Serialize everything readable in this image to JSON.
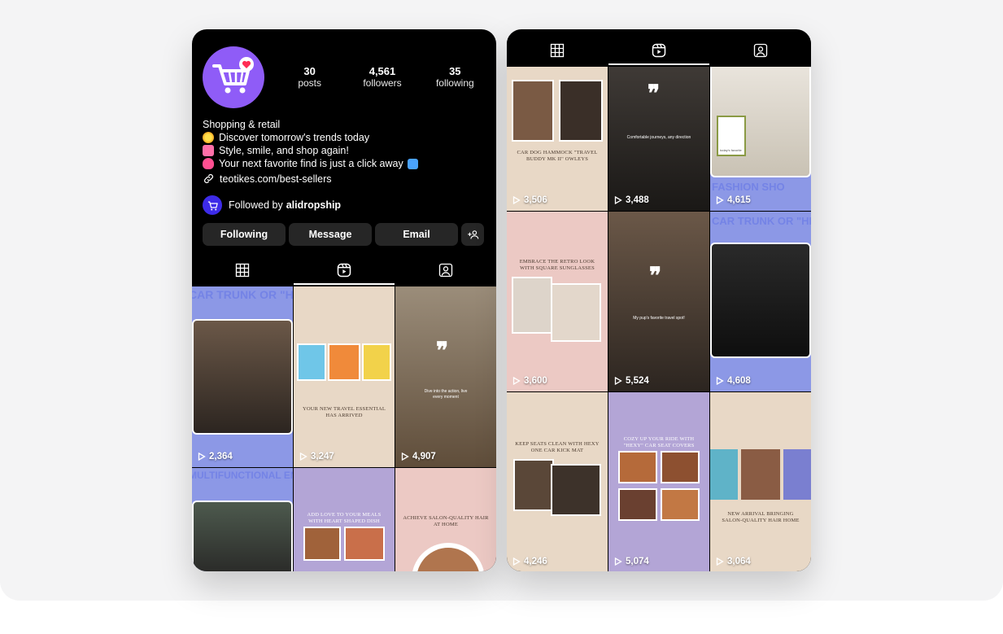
{
  "profile": {
    "stats": [
      {
        "value": "30",
        "label": "posts"
      },
      {
        "value": "4,561",
        "label": "followers"
      },
      {
        "value": "35",
        "label": "following"
      }
    ],
    "bio": {
      "category": "Shopping & retail",
      "line1": "Discover tomorrow's trends today",
      "line2": "Style, smile, and shop again!",
      "line3": "Your next favorite find is just a click away"
    },
    "link": "teotikes.com/best-sellers",
    "followed_by_prefix": "Followed by",
    "followed_by_name": "alidropship",
    "buttons": {
      "following": "Following",
      "message": "Message",
      "email": "Email"
    }
  },
  "icons": {
    "grid": "grid-icon",
    "reels": "reels-icon",
    "tagged": "tagged-icon",
    "link": "link-icon",
    "add_user": "add-user-icon",
    "play": "play-icon",
    "avatar_logo": "shopping-cart-heart-icon"
  },
  "colors": {
    "accent": "#8f5cf7",
    "background": "#000000",
    "button": "#262626"
  },
  "left_grid": [
    {
      "views": "2,364",
      "banner": "CAR TRUNK OR \"HEXY\" BY"
    },
    {
      "views": "3,247",
      "caption": "YOUR NEW TRAVEL ESSENTIAL HAS ARRIVED"
    },
    {
      "views": "4,907",
      "overlay": "Dive into the action, live every moment"
    },
    {
      "banner": "MULTIFUNCTIONAL ENAMEL MICRO PI"
    },
    {
      "caption": "ADD LOVE TO YOUR MEALS WITH HEART SHAPED DISH"
    },
    {
      "caption": "ACHIEVE SALON-QUALITY HAIR AT HOME"
    }
  ],
  "right_grid": [
    {
      "views": "3,506",
      "caption": "CAR DOG HAMMOCK \"TRAVEL BUDDY MK II\" OWLEYS"
    },
    {
      "views": "3,488",
      "overlay": "Comfortable journeys, any direction"
    },
    {
      "views": "4,615",
      "banner": "FASHION SHO",
      "tag": "today's favorite"
    },
    {
      "views": "3,600",
      "caption": "EMBRACE THE RETRO LOOK WITH SQUARE SUNGLASSES"
    },
    {
      "views": "5,524",
      "overlay": "My pup's favorite travel spot!"
    },
    {
      "views": "4,608",
      "banner": "CAR TRUNK OR \"HIGHWAY\" BY"
    },
    {
      "views": "4,246",
      "caption": "KEEP SEATS CLEAN WITH HEXY ONE CAR KICK MAT"
    },
    {
      "views": "5,074",
      "caption": "COZY UP YOUR RIDE WITH \"HEXY\" CAR SEAT COVERS"
    },
    {
      "views": "3,064",
      "caption": "NEW ARRIVAL BRINGING SALON-QUALITY HAIR HOME"
    }
  ]
}
